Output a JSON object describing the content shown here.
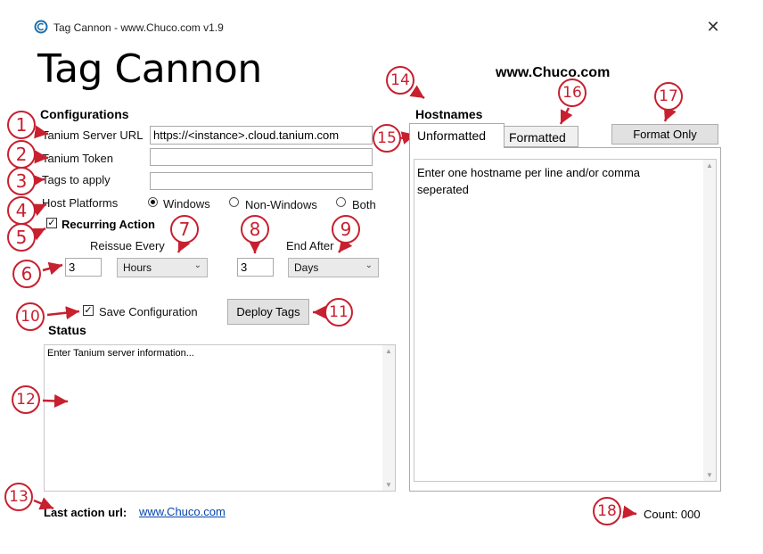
{
  "window": {
    "title": "Tag Cannon - www.Chuco.com v1.9",
    "close_icon": "close-icon"
  },
  "app": {
    "title": "Tag Cannon",
    "site": "www.Chuco.com"
  },
  "config": {
    "heading": "Configurations",
    "server_url_label": "Tanium Server URL",
    "server_url_value": "https://<instance>.cloud.tanium.com",
    "token_label": "Tanium Token",
    "token_value": "",
    "tags_label": "Tags to apply",
    "tags_value": "",
    "platforms_label": "Host Platforms",
    "platforms": [
      "Windows",
      "Non-Windows",
      "Both"
    ],
    "platform_selected": "Windows",
    "recurring_label": "Recurring Action",
    "recurring_checked": true,
    "reissue_label": "Reissue Every",
    "reissue_value": "3",
    "reissue_unit": "Hours",
    "end_after_label": "End After",
    "end_after_value": "3",
    "end_after_unit": "Days",
    "save_label": "Save Configuration",
    "save_checked": true,
    "deploy_label": "Deploy Tags"
  },
  "status": {
    "heading": "Status",
    "text": "Enter Tanium server information..."
  },
  "footer": {
    "last_url_label": "Last action url:",
    "last_url_link": "www.Chuco.com",
    "count": "Count: 000"
  },
  "hostnames": {
    "heading": "Hostnames",
    "tabs": [
      "Unformatted",
      "Formatted"
    ],
    "active_tab": "Unformatted",
    "format_button": "Format Only",
    "placeholder": "Enter one hostname per line and/or comma seperated"
  },
  "annotations": [
    "1",
    "2",
    "3",
    "4",
    "5",
    "6",
    "7",
    "8",
    "9",
    "10",
    "11",
    "12",
    "13",
    "14",
    "15",
    "16",
    "17",
    "18"
  ],
  "colors": {
    "annotation": "#c8202f",
    "link": "#0645ad",
    "button": "#e1e1e1"
  }
}
